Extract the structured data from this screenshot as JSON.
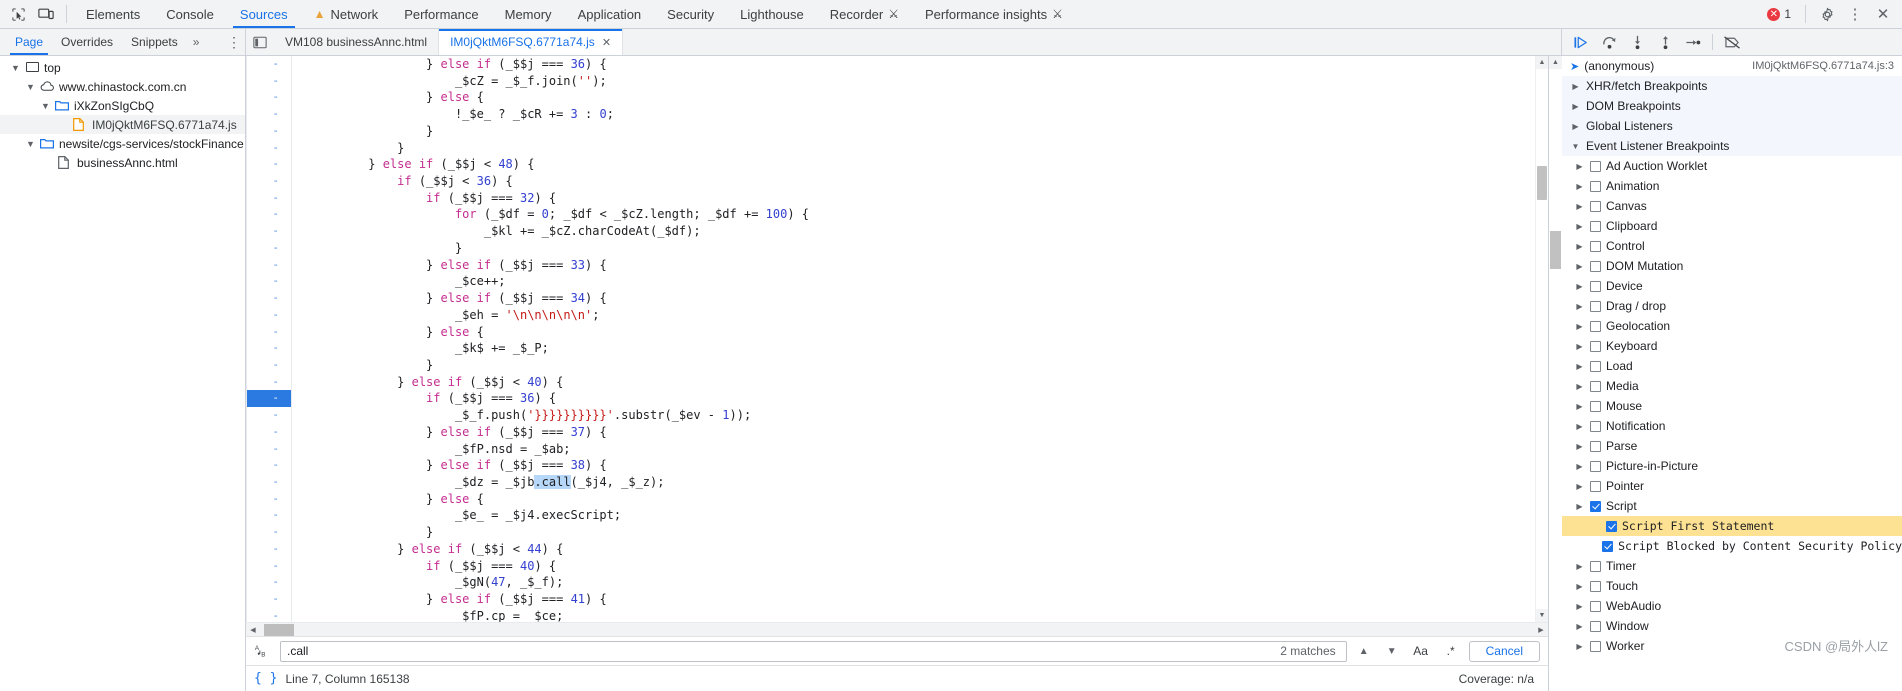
{
  "window": {
    "title": "Chrome DevTools — Sources"
  },
  "toolbar": {
    "inspect_icon": "inspect-element-icon",
    "device_icon": "device-toolbar-icon",
    "tabs": [
      {
        "label": "Elements",
        "active": false,
        "icon": null
      },
      {
        "label": "Console",
        "active": false,
        "icon": null
      },
      {
        "label": "Sources",
        "active": true,
        "icon": null
      },
      {
        "label": "Network",
        "active": false,
        "icon": "warning-triangle-icon"
      },
      {
        "label": "Performance",
        "active": false,
        "icon": null
      },
      {
        "label": "Memory",
        "active": false,
        "icon": null
      },
      {
        "label": "Application",
        "active": false,
        "icon": null
      },
      {
        "label": "Security",
        "active": false,
        "icon": null
      },
      {
        "label": "Lighthouse",
        "active": false,
        "icon": null
      },
      {
        "label": "Recorder",
        "active": false,
        "icon": "flask-icon"
      },
      {
        "label": "Performance insights",
        "active": false,
        "icon": "flask-icon"
      }
    ],
    "error_count": "1",
    "settings_icon": "gear-icon",
    "more_icon": "vertical-dots-icon",
    "close_icon": "close-icon"
  },
  "navigator": {
    "tabs": [
      {
        "label": "Page",
        "active": true
      },
      {
        "label": "Overrides",
        "active": false
      },
      {
        "label": "Snippets",
        "active": false
      }
    ],
    "more_tabs_label": "»",
    "more_options_icon": "vertical-dots-icon",
    "tree": [
      {
        "label": "top",
        "icon": "frame-icon",
        "indent": 0,
        "twisty": "down",
        "selected": false
      },
      {
        "label": "www.chinastock.com.cn",
        "icon": "cloud-icon",
        "indent": 1,
        "twisty": "down",
        "selected": false
      },
      {
        "label": "iXkZonSIgCbQ",
        "icon": "folder-icon",
        "indent": 2,
        "twisty": "down",
        "selected": false
      },
      {
        "label": "IM0jQktM6FSQ.6771a74.js",
        "icon": "js-file-icon",
        "indent": 3,
        "twisty": "none",
        "selected": true
      },
      {
        "label": "newsite/cgs-services/stockFinance",
        "icon": "folder-icon",
        "indent": 2,
        "twisty": "down",
        "selected": false
      },
      {
        "label": "businessAnnc.html",
        "icon": "html-file-icon",
        "indent": 3,
        "twisty": "none",
        "selected": false
      }
    ]
  },
  "editor": {
    "panel_toggle_icon": "show-navigator-icon",
    "tabs": [
      {
        "label": "VM108 businessAnnc.html",
        "active": false,
        "closable": false
      },
      {
        "label": "IM0jQktM6FSQ.6771a74.js",
        "active": true,
        "closable": true
      }
    ],
    "close_icon": "close-icon",
    "gutter_marker": "-",
    "highlighted_line_index": 20,
    "lines": [
      [
        {
          "t": "                  } ",
          "c": "pl"
        },
        {
          "t": "else if",
          "c": "kw"
        },
        {
          "t": " (_$$j === ",
          "c": "pl"
        },
        {
          "t": "36",
          "c": "num"
        },
        {
          "t": ") {",
          "c": "pl"
        }
      ],
      [
        {
          "t": "                      _$cZ = _$_f.join(",
          "c": "pl"
        },
        {
          "t": "''",
          "c": "str"
        },
        {
          "t": ");",
          "c": "pl"
        }
      ],
      [
        {
          "t": "                  } ",
          "c": "pl"
        },
        {
          "t": "else",
          "c": "kw"
        },
        {
          "t": " {",
          "c": "pl"
        }
      ],
      [
        {
          "t": "                      !_$e_ ? _$cR += ",
          "c": "pl"
        },
        {
          "t": "3",
          "c": "num"
        },
        {
          "t": " : ",
          "c": "pl"
        },
        {
          "t": "0",
          "c": "num"
        },
        {
          "t": ";",
          "c": "pl"
        }
      ],
      [
        {
          "t": "                  }",
          "c": "pl"
        }
      ],
      [
        {
          "t": "              }",
          "c": "pl"
        }
      ],
      [
        {
          "t": "          } ",
          "c": "pl"
        },
        {
          "t": "else if",
          "c": "kw"
        },
        {
          "t": " (_$$j < ",
          "c": "pl"
        },
        {
          "t": "48",
          "c": "num"
        },
        {
          "t": ") {",
          "c": "pl"
        }
      ],
      [
        {
          "t": "              ",
          "c": "pl"
        },
        {
          "t": "if",
          "c": "kw"
        },
        {
          "t": " (_$$j < ",
          "c": "pl"
        },
        {
          "t": "36",
          "c": "num"
        },
        {
          "t": ") {",
          "c": "pl"
        }
      ],
      [
        {
          "t": "                  ",
          "c": "pl"
        },
        {
          "t": "if",
          "c": "kw"
        },
        {
          "t": " (_$$j === ",
          "c": "pl"
        },
        {
          "t": "32",
          "c": "num"
        },
        {
          "t": ") {",
          "c": "pl"
        }
      ],
      [
        {
          "t": "                      ",
          "c": "pl"
        },
        {
          "t": "for",
          "c": "kw"
        },
        {
          "t": " (_$df = ",
          "c": "pl"
        },
        {
          "t": "0",
          "c": "num"
        },
        {
          "t": "; _$df < _$cZ.length; _$df += ",
          "c": "pl"
        },
        {
          "t": "100",
          "c": "num"
        },
        {
          "t": ") {",
          "c": "pl"
        }
      ],
      [
        {
          "t": "                          _$kl += _$cZ.charCodeAt(_$df);",
          "c": "pl"
        }
      ],
      [
        {
          "t": "                      }",
          "c": "pl"
        }
      ],
      [
        {
          "t": "                  } ",
          "c": "pl"
        },
        {
          "t": "else if",
          "c": "kw"
        },
        {
          "t": " (_$$j === ",
          "c": "pl"
        },
        {
          "t": "33",
          "c": "num"
        },
        {
          "t": ") {",
          "c": "pl"
        }
      ],
      [
        {
          "t": "                      _$ce++;",
          "c": "pl"
        }
      ],
      [
        {
          "t": "                  } ",
          "c": "pl"
        },
        {
          "t": "else if",
          "c": "kw"
        },
        {
          "t": " (_$$j === ",
          "c": "pl"
        },
        {
          "t": "34",
          "c": "num"
        },
        {
          "t": ") {",
          "c": "pl"
        }
      ],
      [
        {
          "t": "                      _$eh = ",
          "c": "pl"
        },
        {
          "t": "'\\n\\n\\n\\n\\n'",
          "c": "str"
        },
        {
          "t": ";",
          "c": "pl"
        }
      ],
      [
        {
          "t": "                  } ",
          "c": "pl"
        },
        {
          "t": "else",
          "c": "kw"
        },
        {
          "t": " {",
          "c": "pl"
        }
      ],
      [
        {
          "t": "                      _$k$ += _$_P;",
          "c": "pl"
        }
      ],
      [
        {
          "t": "                  }",
          "c": "pl"
        }
      ],
      [
        {
          "t": "              } ",
          "c": "pl"
        },
        {
          "t": "else if",
          "c": "kw"
        },
        {
          "t": " (_$$j < ",
          "c": "pl"
        },
        {
          "t": "40",
          "c": "num"
        },
        {
          "t": ") {",
          "c": "pl"
        }
      ],
      [
        {
          "t": "                  ",
          "c": "pl"
        },
        {
          "t": "if",
          "c": "kw"
        },
        {
          "t": " (_$$j === ",
          "c": "pl"
        },
        {
          "t": "36",
          "c": "num"
        },
        {
          "t": ") {",
          "c": "pl"
        }
      ],
      [
        {
          "t": "                      _$_f.push(",
          "c": "pl"
        },
        {
          "t": "'}}}}}}}}}}'",
          "c": "str"
        },
        {
          "t": ".substr(_$ev - ",
          "c": "pl"
        },
        {
          "t": "1",
          "c": "num"
        },
        {
          "t": "));",
          "c": "pl"
        }
      ],
      [
        {
          "t": "                  } ",
          "c": "pl"
        },
        {
          "t": "else if",
          "c": "kw"
        },
        {
          "t": " (_$$j === ",
          "c": "pl"
        },
        {
          "t": "37",
          "c": "num"
        },
        {
          "t": ") {",
          "c": "pl"
        }
      ],
      [
        {
          "t": "                      _$fP.nsd = _$ab;",
          "c": "pl"
        }
      ],
      [
        {
          "t": "                  } ",
          "c": "pl"
        },
        {
          "t": "else if",
          "c": "kw"
        },
        {
          "t": " (_$$j === ",
          "c": "pl"
        },
        {
          "t": "38",
          "c": "num"
        },
        {
          "t": ") {",
          "c": "pl"
        }
      ],
      [
        {
          "t": "                      _$dz = _$jb",
          "c": "pl"
        },
        {
          "t": ".call",
          "c": "sel"
        },
        {
          "t": "(_$j4, _$_z);",
          "c": "pl"
        }
      ],
      [
        {
          "t": "                  } ",
          "c": "pl"
        },
        {
          "t": "else",
          "c": "kw"
        },
        {
          "t": " {",
          "c": "pl"
        }
      ],
      [
        {
          "t": "                      _$e_ = _$j4.execScript;",
          "c": "pl"
        }
      ],
      [
        {
          "t": "                  }",
          "c": "pl"
        }
      ],
      [
        {
          "t": "              } ",
          "c": "pl"
        },
        {
          "t": "else if",
          "c": "kw"
        },
        {
          "t": " (_$$j < ",
          "c": "pl"
        },
        {
          "t": "44",
          "c": "num"
        },
        {
          "t": ") {",
          "c": "pl"
        }
      ],
      [
        {
          "t": "                  ",
          "c": "pl"
        },
        {
          "t": "if",
          "c": "kw"
        },
        {
          "t": " (_$$j === ",
          "c": "pl"
        },
        {
          "t": "40",
          "c": "num"
        },
        {
          "t": ") {",
          "c": "pl"
        }
      ],
      [
        {
          "t": "                      _$gN(",
          "c": "pl"
        },
        {
          "t": "47",
          "c": "num"
        },
        {
          "t": ", _$_f);",
          "c": "pl"
        }
      ],
      [
        {
          "t": "                  } ",
          "c": "pl"
        },
        {
          "t": "else if",
          "c": "kw"
        },
        {
          "t": " (_$$j === ",
          "c": "pl"
        },
        {
          "t": "41",
          "c": "num"
        },
        {
          "t": ") {",
          "c": "pl"
        }
      ],
      [
        {
          "t": "                      _$fP.cp = _$ce;",
          "c": "pl"
        }
      ]
    ]
  },
  "search": {
    "icon": "match-case-regex-icon",
    "value": ".call",
    "placeholder": "Find",
    "matches_label": "2 matches",
    "prev_icon": "chevron-up-icon",
    "next_icon": "chevron-down-icon",
    "match_case_label": "Aa",
    "regex_label": ".*",
    "cancel_label": "Cancel"
  },
  "status": {
    "pretty_print_icon": "format-braces-icon",
    "position": "Line 7, Column 165138",
    "coverage": "Coverage: n/a"
  },
  "debugger": {
    "toolbar": [
      {
        "icon": "resume-script-icon",
        "name": "resume-button"
      },
      {
        "icon": "step-over-icon",
        "name": "step-over-button"
      },
      {
        "icon": "step-into-icon",
        "name": "step-into-button"
      },
      {
        "icon": "step-out-icon",
        "name": "step-out-button"
      },
      {
        "icon": "step-icon",
        "name": "step-button"
      },
      {
        "icon": "deactivate-breakpoints-icon",
        "name": "deactivate-breakpoints-button"
      }
    ],
    "call_frame": {
      "label": "(anonymous)",
      "location": "IM0jQktM6FSQ.6771a74.js:3"
    },
    "sections": [
      {
        "label": "XHR/fetch Breakpoints",
        "expanded": false
      },
      {
        "label": "DOM Breakpoints",
        "expanded": false
      },
      {
        "label": "Global Listeners",
        "expanded": false
      },
      {
        "label": "Event Listener Breakpoints",
        "expanded": true
      }
    ],
    "event_categories": [
      {
        "label": "Ad Auction Worklet",
        "checked": false
      },
      {
        "label": "Animation",
        "checked": false
      },
      {
        "label": "Canvas",
        "checked": false
      },
      {
        "label": "Clipboard",
        "checked": false
      },
      {
        "label": "Control",
        "checked": false
      },
      {
        "label": "DOM Mutation",
        "checked": false
      },
      {
        "label": "Device",
        "checked": false
      },
      {
        "label": "Drag / drop",
        "checked": false
      },
      {
        "label": "Geolocation",
        "checked": false
      },
      {
        "label": "Keyboard",
        "checked": false
      },
      {
        "label": "Load",
        "checked": false
      },
      {
        "label": "Media",
        "checked": false
      },
      {
        "label": "Mouse",
        "checked": false
      },
      {
        "label": "Notification",
        "checked": false
      },
      {
        "label": "Parse",
        "checked": false
      },
      {
        "label": "Picture-in-Picture",
        "checked": false
      },
      {
        "label": "Pointer",
        "checked": false
      },
      {
        "label": "Script",
        "checked": true
      }
    ],
    "script_children": [
      {
        "label": "Script First Statement",
        "checked": true,
        "highlighted": true
      },
      {
        "label": "Script Blocked by Content Security Policy",
        "checked": true,
        "highlighted": false
      }
    ],
    "trailing_categories": [
      {
        "label": "Timer",
        "checked": false
      },
      {
        "label": "Touch",
        "checked": false
      },
      {
        "label": "WebAudio",
        "checked": false
      },
      {
        "label": "Window",
        "checked": false
      },
      {
        "label": "Worker",
        "checked": false
      }
    ]
  },
  "watermark": "CSDN @局外人lZ",
  "colors": {
    "accent": "#1a73e8",
    "error": "#eb3941",
    "highlight": "#fde293",
    "selection": "#b6d7f7",
    "keyword": "#c42d8f",
    "number": "#3340d0",
    "string": "#c41a16"
  }
}
